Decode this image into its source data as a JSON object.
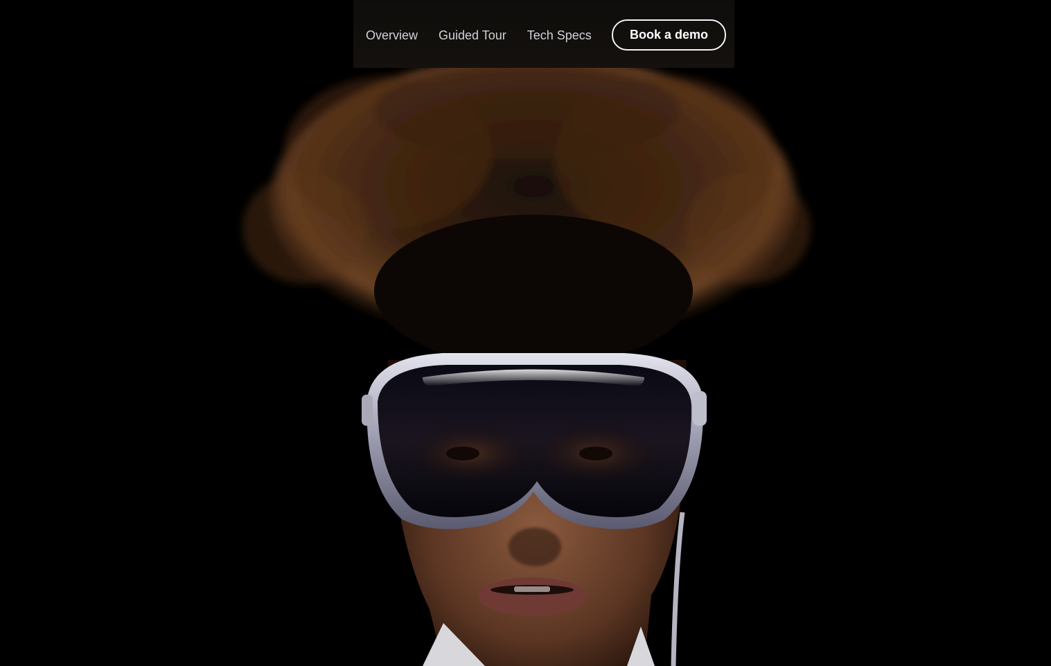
{
  "nav": {
    "links": [
      {
        "label": "Overview"
      },
      {
        "label": "Guided Tour"
      },
      {
        "label": "Tech Specs"
      }
    ],
    "cta_label": "Book a demo"
  },
  "hero": {
    "image_subject": "person-wearing-headset",
    "background_color": "#000000"
  }
}
